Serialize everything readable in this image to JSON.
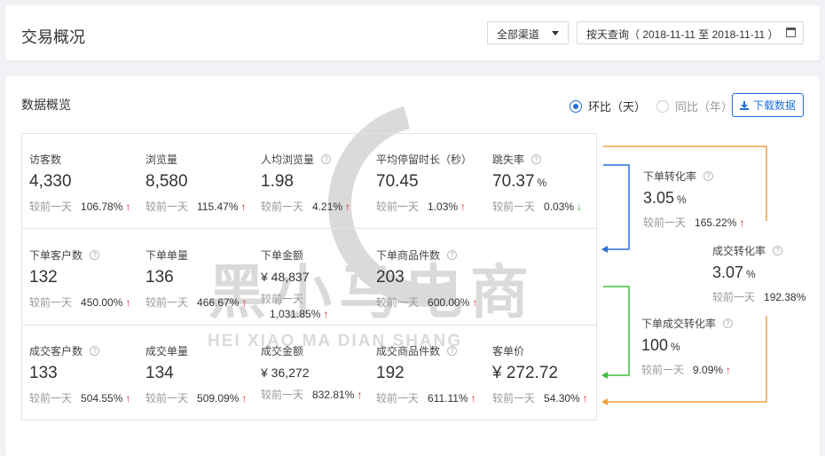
{
  "header": {
    "title": "交易概况",
    "channel_select": "全部渠道",
    "date_query": "按天查询（ 2018-11-11 至 2018-11-11 ）"
  },
  "overview": {
    "title": "数据概览",
    "radio_day": "环比（天）",
    "radio_year": "同比（年）",
    "download": "下载数据",
    "cmp_label": "较前一天"
  },
  "watermark": {
    "cn": "黑小马电商",
    "en": "HEI XIAO MA DIAN SHANG"
  },
  "metrics": {
    "visitors": {
      "label": "访客数",
      "value": "4,330",
      "cmp": "106.78%"
    },
    "pageviews": {
      "label": "浏览量",
      "value": "8,580",
      "cmp": "115.47%"
    },
    "avg_pv": {
      "label": "人均浏览量",
      "value": "1.98",
      "cmp": "4.21%"
    },
    "avg_stay": {
      "label": "平均停留时长（秒）",
      "value": "70.45",
      "cmp": "1.03%"
    },
    "bounce": {
      "label": "跳失率",
      "value": "70.37",
      "unit": "%",
      "cmp": "0.03%"
    },
    "order_customers": {
      "label": "下单客户数",
      "value": "132",
      "cmp": "450.00%"
    },
    "order_count": {
      "label": "下单单量",
      "value": "136",
      "cmp": "466.67%"
    },
    "order_amount": {
      "label": "下单金额",
      "value": "¥ 48,837",
      "cmp": "1,031.85%"
    },
    "order_items": {
      "label": "下单商品件数",
      "value": "203",
      "cmp": "600.00%"
    },
    "deal_customers": {
      "label": "成交客户数",
      "value": "133",
      "cmp": "504.55%"
    },
    "deal_count": {
      "label": "成交单量",
      "value": "134",
      "cmp": "509.09%"
    },
    "deal_amount": {
      "label": "成交金额",
      "value": "¥ 36,272",
      "cmp": "832.81%"
    },
    "deal_items": {
      "label": "成交商品件数",
      "value": "192",
      "cmp": "611.11%"
    },
    "avg_order": {
      "label": "客单价",
      "value": "¥ 272.72",
      "cmp": "54.30%"
    }
  },
  "conversion": {
    "order_rate": {
      "label": "下单转化率",
      "value": "3.05",
      "unit": "%",
      "cmp": "165.22%"
    },
    "deal_rate": {
      "label": "成交转化率",
      "value": "3.07",
      "unit": "%",
      "cmp": "192.38%"
    },
    "order_deal_rate": {
      "label": "下单成交转化率",
      "value": "100",
      "unit": "%",
      "cmp": "9.09%"
    }
  },
  "colors": {
    "accent": "#1e6fd9",
    "up": "#e02020",
    "down": "#2aa52a",
    "blue_flow": "#2a6fd8",
    "green_flow": "#3cbf3c",
    "orange_flow": "#f0a040"
  },
  "icons": {
    "caret": "caret-down-icon",
    "calendar": "calendar-icon",
    "download": "download-icon",
    "help": "question-circle-icon",
    "up": "↑",
    "down": "↓"
  }
}
